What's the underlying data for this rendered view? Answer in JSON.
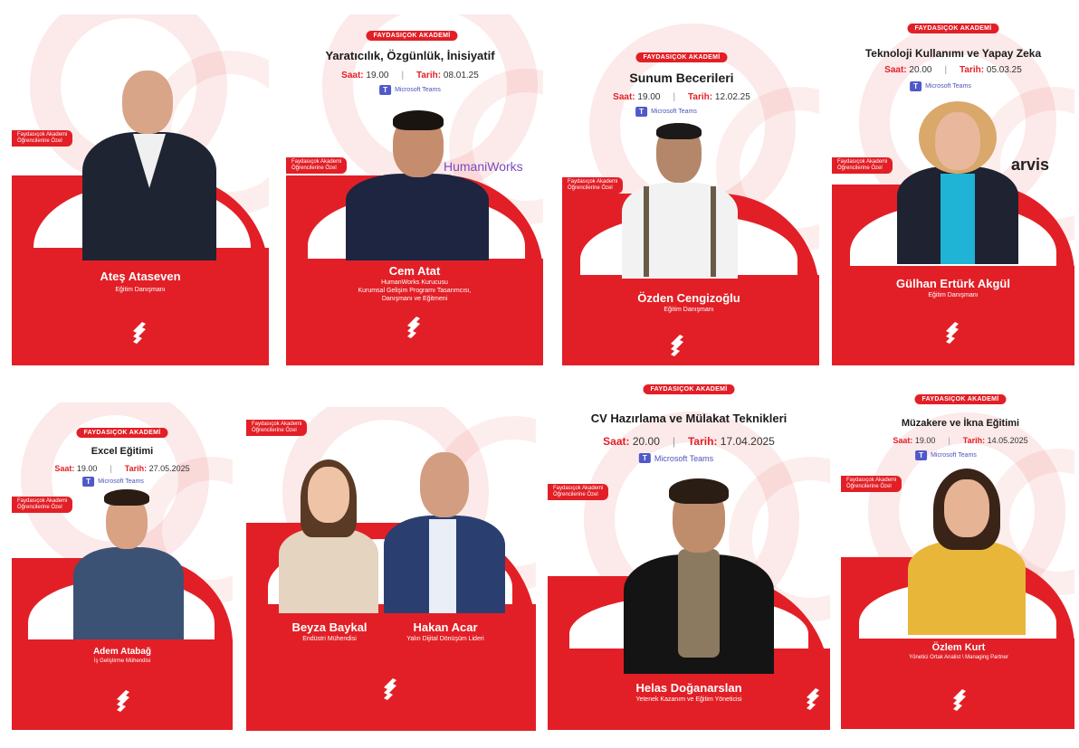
{
  "brand": "FAYDASIÇOK AKADEMİ",
  "ribbon": [
    "Faydasıçok Akademi",
    "Öğrencilerine Özel"
  ],
  "labels": {
    "saat": "Saat:",
    "tarih": "Tarih:",
    "sep": "|"
  },
  "teams_label": "Microsoft Teams",
  "colors": {
    "accent": "#e21f26",
    "teams": "#5059c9"
  },
  "cards": [
    {
      "name": "Ateş Ataseven",
      "role": [
        "Eğitim Danışmanı"
      ]
    },
    {
      "title": "Yaratıcılık, Özgünlük, İnisiyatif",
      "saat": "19.00",
      "tarih": "08.01.25",
      "name": "Cem Atat",
      "role": [
        "HumanWorks Kurucusu",
        "Kurumsal Gelişim Programı Tasarımcısı,",
        "Danışmanı ve Eğitmeni"
      ],
      "sponsor": "HumaniWorks"
    },
    {
      "title": "Sunum Becerileri",
      "saat": "19.00",
      "tarih": "12.02.25",
      "name": "Özden Cengizoğlu",
      "role": [
        "Eğitim Danışmanı"
      ]
    },
    {
      "title": "Teknoloji Kullanımı ve Yapay Zeka",
      "saat": "20.00",
      "tarih": "05.03.25",
      "name": "Gülhan Ertürk Akgül",
      "role": [
        "Eğitim Danışmanı"
      ],
      "sponsor": "arvis"
    },
    {
      "title": "Excel Eğitimi",
      "saat": "19.00",
      "tarih": "27.05.2025",
      "name": "Adem Atabağ",
      "role": [
        "İş Geliştirme Mühendisi"
      ]
    },
    {
      "names": [
        "Beyza Baykal",
        "Hakan Acar"
      ],
      "roles": [
        "Endüstri Mühendisi",
        "Yalın Dijital Dönüşüm Lideri"
      ]
    },
    {
      "title": "CV Hazırlama ve Mülakat Teknikleri",
      "saat": "20.00",
      "tarih": "17.04.2025",
      "name": "Helas Doğanarslan",
      "role": [
        "Yetenek Kazanım ve Eğitim Yöneticisi"
      ]
    },
    {
      "title": "Müzakere ve İkna Eğitimi",
      "saat": "19.00",
      "tarih": "14.05.2025",
      "name": "Özlem Kurt",
      "role": [
        "Yönetici Ortak Analist \\ Managing Partner"
      ]
    }
  ]
}
